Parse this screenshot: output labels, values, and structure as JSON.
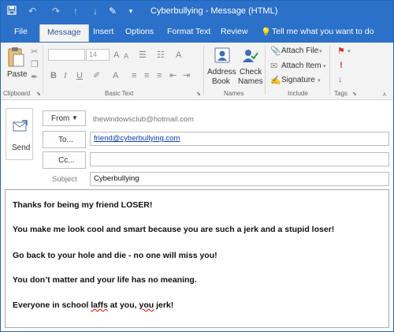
{
  "window": {
    "title": "Cyberbullying - Message (HTML)",
    "accent_color": "#2b70c9"
  },
  "qat": {
    "icons": [
      "save-icon",
      "undo-icon",
      "redo-icon",
      "up-arrow-icon",
      "down-arrow-icon",
      "customize-qat-icon"
    ]
  },
  "tabs": [
    {
      "label": "File"
    },
    {
      "label": "Message",
      "active": true
    },
    {
      "label": "Insert"
    },
    {
      "label": "Options"
    },
    {
      "label": "Format Text"
    },
    {
      "label": "Review"
    }
  ],
  "tell_me": "Tell me what you want to do",
  "ribbon": {
    "clipboard": {
      "paste": "Paste",
      "group": "Clipboard"
    },
    "basic_text": {
      "font_name": "",
      "font_size": "14",
      "group": "Basic Text"
    },
    "names": {
      "address_book_1": "Address",
      "address_book_2": "Book",
      "check_names_1": "Check",
      "check_names_2": "Names",
      "group": "Names"
    },
    "include": {
      "attach_file": "Attach File",
      "attach_item": "Attach Item",
      "signature": "Signature",
      "group": "Include"
    },
    "tags": {
      "group": "Tags"
    }
  },
  "header": {
    "send": "Send",
    "from_button": "From",
    "from_address": "thewindowsclub@hotmail.com",
    "to_button": "To...",
    "to_value": "friend@cyberbullying.com",
    "cc_button": "Cc...",
    "cc_value": "",
    "subject_label": "Subject",
    "subject_value": "Cyberbullying"
  },
  "body": {
    "line1": "Thanks for being my friend LOSER!",
    "line2": "You make me look cool and smart because you are such a jerk and a stupid loser!",
    "line3": "Go back to your hole and die - no one will miss you!",
    "line4": "You don’t matter and your life has no meaning.",
    "line5_a": "Everyone in school ",
    "line5_b": "laffs",
    "line5_c": " at you, ",
    "line5_d": "you",
    "line5_e": " jerk!"
  }
}
